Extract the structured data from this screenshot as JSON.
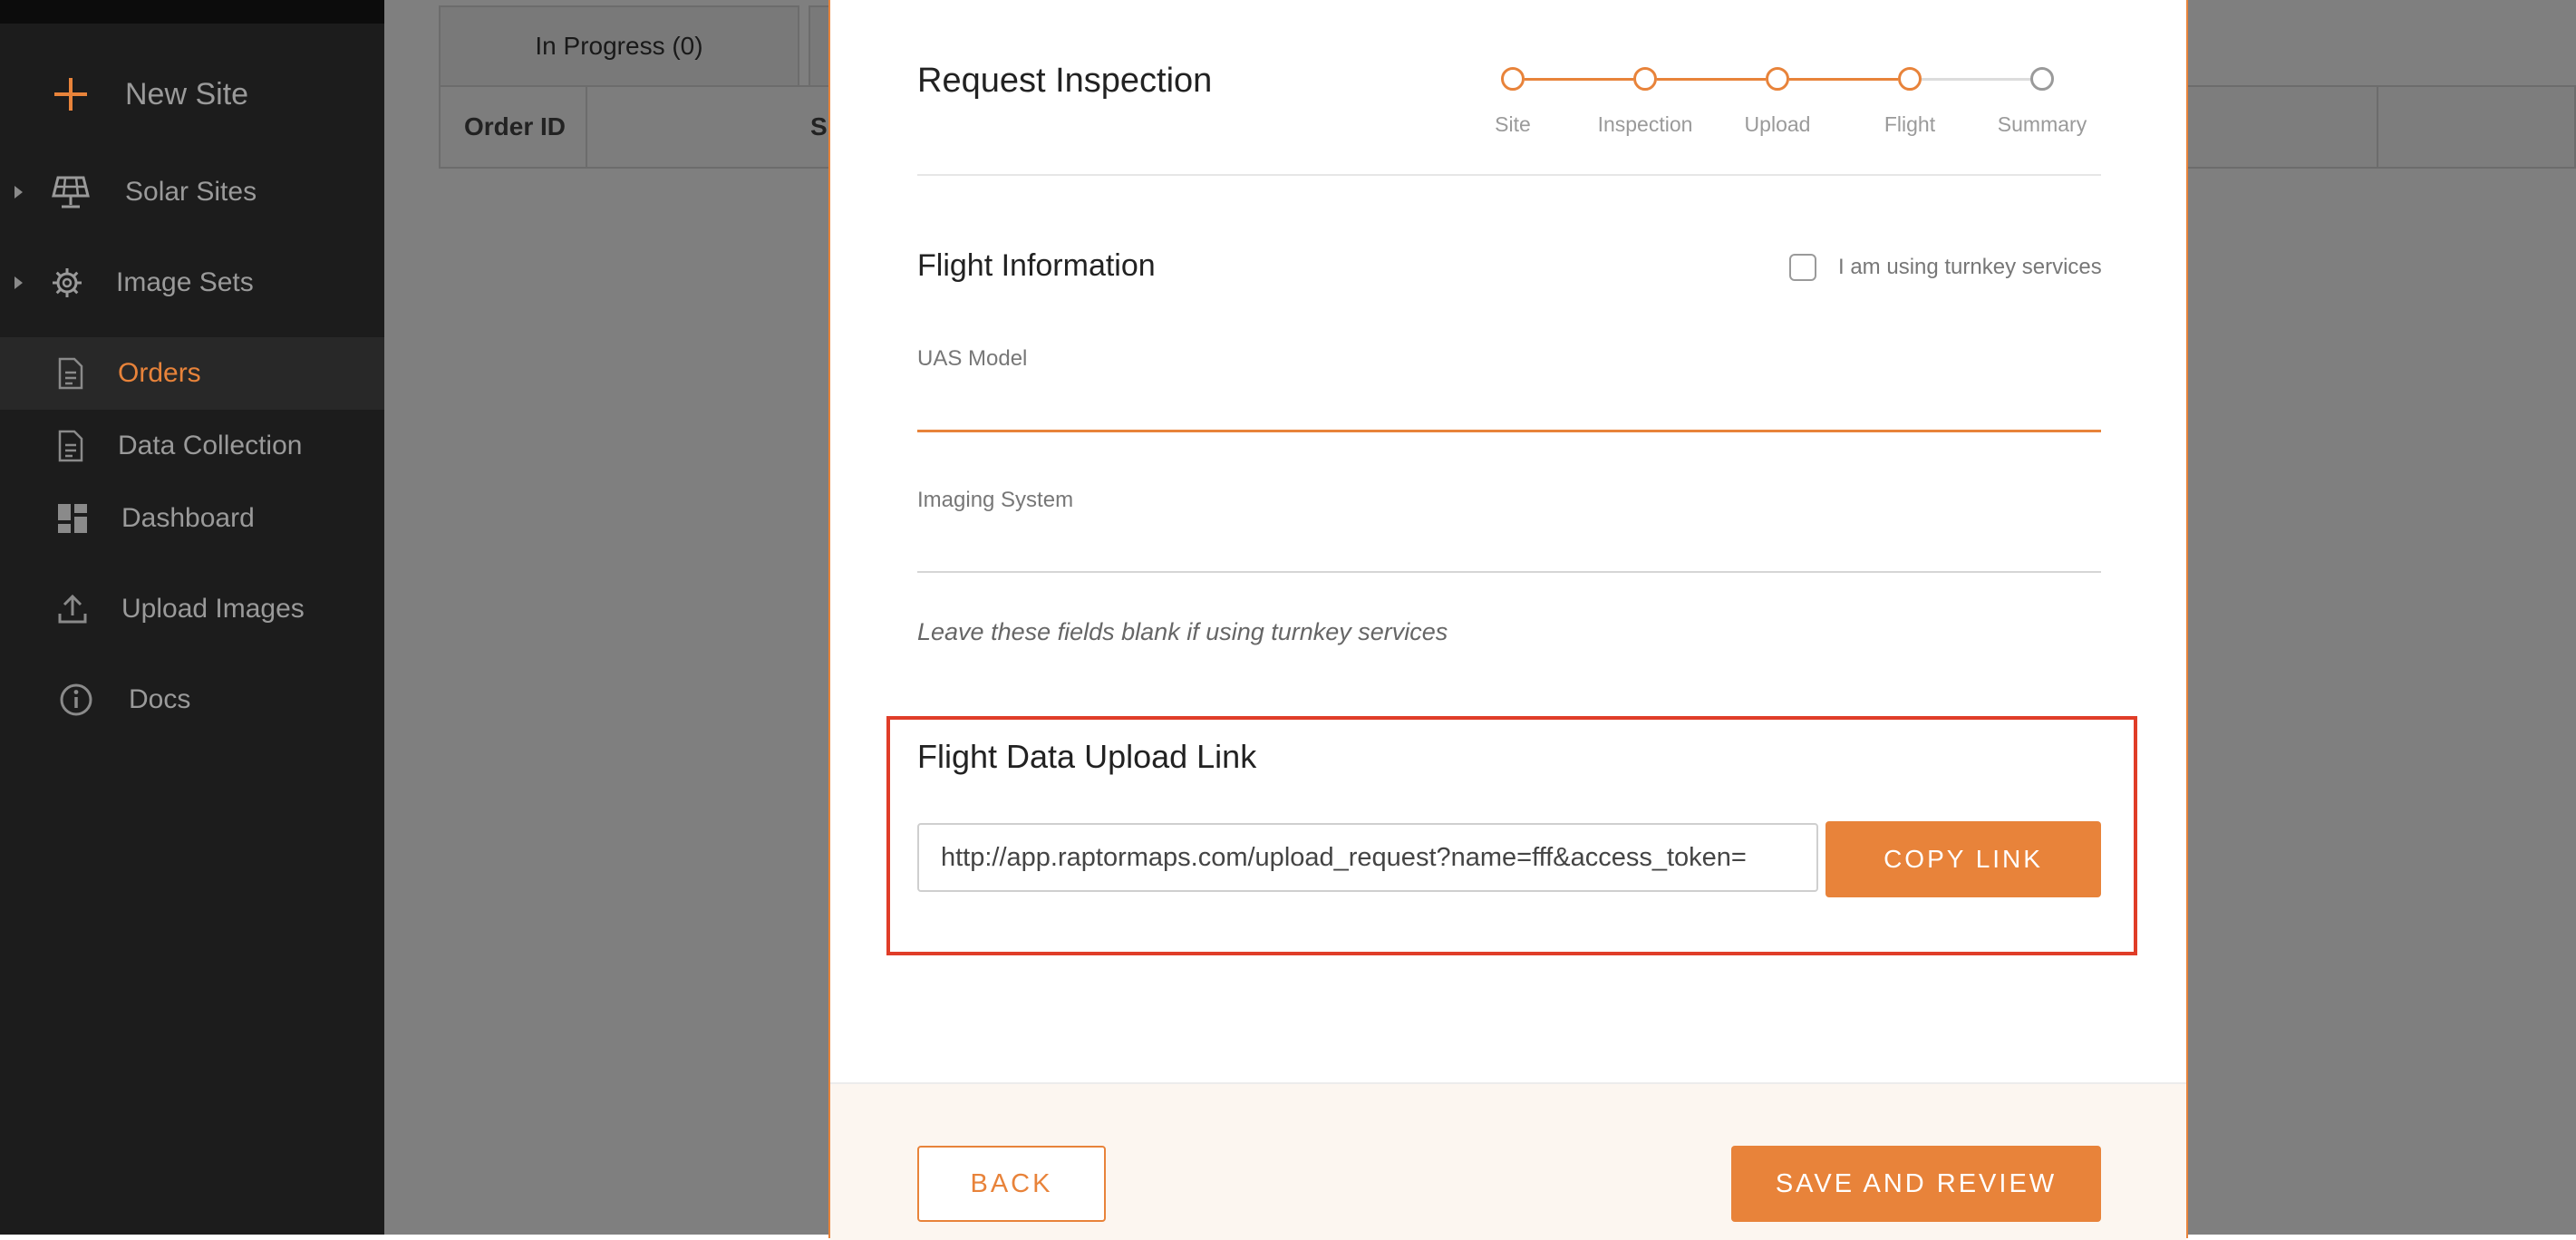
{
  "sidebar": {
    "items": [
      {
        "label": "New Site",
        "icon": "plus-icon"
      },
      {
        "label": "Solar Sites",
        "icon": "solar-panel-icon"
      },
      {
        "label": "Image Sets",
        "icon": "gear-icon"
      },
      {
        "label": "Orders",
        "icon": "document-icon",
        "active": true
      },
      {
        "label": "Data Collection",
        "icon": "document-icon"
      },
      {
        "label": "Dashboard",
        "icon": "dashboard-icon"
      },
      {
        "label": "Upload Images",
        "icon": "upload-icon"
      },
      {
        "label": "Docs",
        "icon": "info-icon"
      }
    ]
  },
  "background": {
    "tab_in_progress": "In Progress (0)",
    "table_headers": [
      "Order ID",
      "S"
    ]
  },
  "modal": {
    "title": "Request Inspection",
    "steps": [
      {
        "label": "Site",
        "completed": true
      },
      {
        "label": "Inspection",
        "completed": true
      },
      {
        "label": "Upload",
        "completed": true
      },
      {
        "label": "Flight",
        "completed": true
      },
      {
        "label": "Summary",
        "completed": false
      }
    ],
    "section_title": "Flight Information",
    "turnkey_label": "I am using turnkey services",
    "turnkey_checked": false,
    "uas_model": {
      "label": "UAS Model",
      "value": ""
    },
    "imaging_system": {
      "label": "Imaging System",
      "value": ""
    },
    "hint": "Leave these fields blank if using turnkey services",
    "upload_link": {
      "title": "Flight Data Upload Link",
      "value": "http://app.raptormaps.com/upload_request?name=fff&access_token=",
      "copy_label": "COPY LINK"
    },
    "footer": {
      "back_label": "BACK",
      "save_label": "SAVE AND REVIEW"
    }
  },
  "colors": {
    "accent": "#e8833a",
    "highlight": "#e03d28",
    "sidebar_bg": "#1c1c1c"
  }
}
